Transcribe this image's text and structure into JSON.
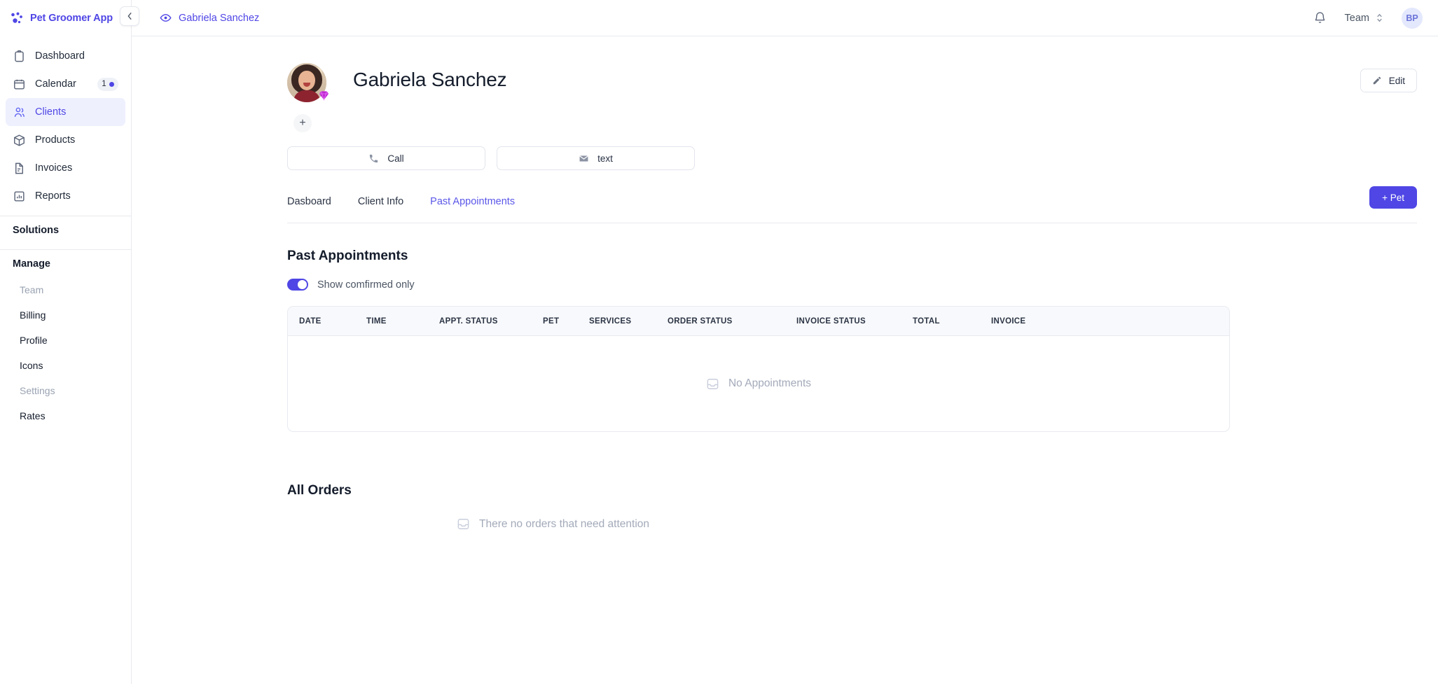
{
  "brand": {
    "name": "Pet Groomer App",
    "logo_icon": "paw-dots-icon",
    "accent": "#4f46e5"
  },
  "sidebar": {
    "items": [
      {
        "label": "Dashboard",
        "icon": "clipboard-icon",
        "active": false
      },
      {
        "label": "Calendar",
        "icon": "calendar-icon",
        "active": false,
        "badge": "1"
      },
      {
        "label": "Clients",
        "icon": "users-icon",
        "active": true
      },
      {
        "label": "Products",
        "icon": "box-icon",
        "active": false
      },
      {
        "label": "Invoices",
        "icon": "document-icon",
        "active": false
      },
      {
        "label": "Reports",
        "icon": "bar-chart-icon",
        "active": false
      }
    ],
    "groups": [
      {
        "heading": "Solutions",
        "items": []
      },
      {
        "heading": "Manage",
        "items": [
          {
            "label": "Team",
            "muted": true
          },
          {
            "label": "Billing",
            "muted": false
          },
          {
            "label": "Profile",
            "muted": false
          },
          {
            "label": "Icons",
            "muted": false
          },
          {
            "label": "Settings",
            "muted": true
          },
          {
            "label": "Rates",
            "muted": false
          }
        ]
      }
    ]
  },
  "topbar": {
    "collapse_icon": "chevron-left-icon",
    "breadcrumb_icon": "eye-icon",
    "breadcrumb": "Gabriela Sanchez",
    "bell_icon": "bell-icon",
    "team_label": "Team",
    "team_chevron_icon": "chevron-up-down-icon",
    "avatar_initials": "BP"
  },
  "profile": {
    "name": "Gabriela Sanchez",
    "avatar_badge_icon": "gem-icon",
    "add_button_label": "+",
    "edit": {
      "label": "Edit",
      "icon": "pencil-icon"
    },
    "actions": [
      {
        "label": "Call",
        "icon": "phone-icon"
      },
      {
        "label": "text",
        "icon": "envelope-icon"
      }
    ]
  },
  "tabs": [
    {
      "label": "Dasboard",
      "active": false
    },
    {
      "label": "Client Info",
      "active": false
    },
    {
      "label": "Past Appointments",
      "active": true
    }
  ],
  "pet_button": {
    "label": "+ Pet",
    "color": "#4f46e5"
  },
  "past_appointments": {
    "title": "Past Appointments",
    "toggle": {
      "label": "Show comfirmed only",
      "on": true
    },
    "columns": [
      "DATE",
      "TIME",
      "APPT. STATUS",
      "PET",
      "SERVICES",
      "ORDER STATUS",
      "INVOICE STATUS",
      "TOTAL",
      "INVOICE"
    ],
    "rows": [],
    "empty_text": "No Appointments",
    "empty_icon": "inbox-icon"
  },
  "all_orders": {
    "title": "All Orders",
    "empty_text": "There no orders that need attention",
    "empty_icon": "inbox-icon"
  }
}
